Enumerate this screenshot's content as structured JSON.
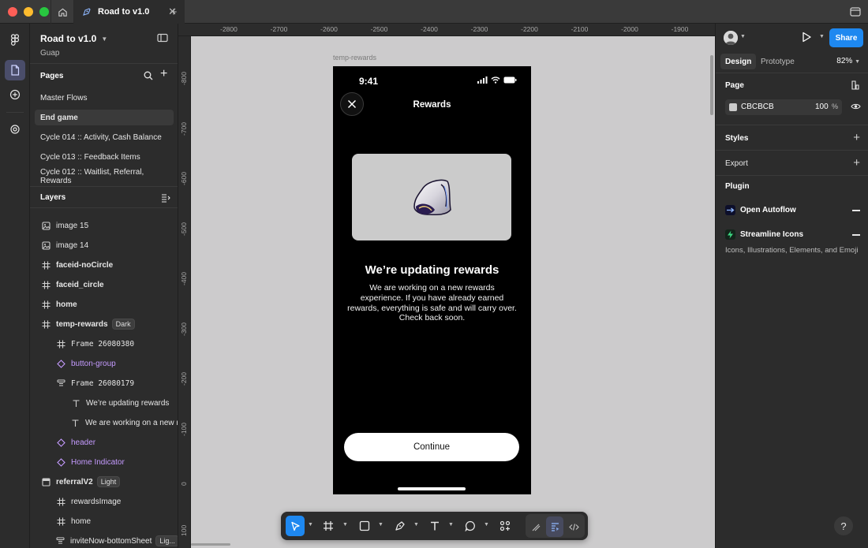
{
  "tab": {
    "title": "Road to v1.0"
  },
  "project": {
    "name": "Road to v1.0",
    "team": "Guap"
  },
  "pages": {
    "title": "Pages",
    "items": [
      {
        "label": "Master Flows",
        "selected": false
      },
      {
        "label": "End game",
        "selected": true
      },
      {
        "label": "Cycle 014 :: Activity, Cash Balance",
        "selected": false
      },
      {
        "label": "Cycle 013 :: Feedback Items",
        "selected": false
      },
      {
        "label": "Cycle 012 :: Waitlist, Referral, Rewards",
        "selected": false
      }
    ]
  },
  "layers": {
    "title": "Layers",
    "items": [
      {
        "label": "image 15",
        "icon": "image-icon",
        "indent": 0,
        "bold": false,
        "purple": false,
        "badge": ""
      },
      {
        "label": "image 14",
        "icon": "image-icon",
        "indent": 0,
        "bold": false,
        "purple": false,
        "badge": ""
      },
      {
        "label": "faceid-noCircle",
        "icon": "frame-icon",
        "indent": 0,
        "bold": true,
        "purple": false,
        "badge": ""
      },
      {
        "label": "faceid_circle",
        "icon": "frame-icon",
        "indent": 0,
        "bold": true,
        "purple": false,
        "badge": ""
      },
      {
        "label": "home",
        "icon": "frame-icon",
        "indent": 0,
        "bold": true,
        "purple": false,
        "badge": ""
      },
      {
        "label": "temp-rewards",
        "icon": "frame-icon",
        "indent": 0,
        "bold": true,
        "purple": false,
        "badge": "Dark"
      },
      {
        "label": "Frame 26080380",
        "icon": "frame-icon",
        "indent": 1,
        "bold": false,
        "purple": false,
        "badge": "",
        "mono": true
      },
      {
        "label": "button-group",
        "icon": "instance-icon",
        "indent": 1,
        "bold": false,
        "purple": true,
        "badge": ""
      },
      {
        "label": "Frame 26080179",
        "icon": "autolayout-icon",
        "indent": 1,
        "bold": false,
        "purple": false,
        "badge": "",
        "mono": true
      },
      {
        "label": "We’re updating rewards",
        "icon": "text-icon",
        "indent": 2,
        "bold": false,
        "purple": false,
        "badge": ""
      },
      {
        "label": "We are working on a new rew",
        "icon": "text-icon",
        "indent": 2,
        "bold": false,
        "purple": false,
        "badge": ""
      },
      {
        "label": "header",
        "icon": "instance-icon",
        "indent": 1,
        "bold": false,
        "purple": true,
        "badge": ""
      },
      {
        "label": "Home Indicator",
        "icon": "instance-icon",
        "indent": 1,
        "bold": false,
        "purple": true,
        "badge": ""
      },
      {
        "label": "referralV2",
        "icon": "section-icon",
        "indent": 0,
        "bold": true,
        "purple": false,
        "badge": "Light"
      },
      {
        "label": "rewardsImage",
        "icon": "frame-icon",
        "indent": 1,
        "bold": false,
        "purple": false,
        "badge": ""
      },
      {
        "label": "home",
        "icon": "frame-icon",
        "indent": 1,
        "bold": false,
        "purple": false,
        "badge": ""
      },
      {
        "label": "inviteNow-bottomSheet",
        "icon": "autolayout-icon",
        "indent": 1,
        "bold": false,
        "purple": false,
        "badge": "Lig..."
      }
    ]
  },
  "rulers": {
    "top": [
      "-2800",
      "-2700",
      "-2600",
      "-2500",
      "-2400",
      "-2300",
      "-2200",
      "-2100",
      "-2000",
      "-1900"
    ],
    "left": [
      "-800",
      "-700",
      "-600",
      "-500",
      "-400",
      "-300",
      "-200",
      "-100",
      "0",
      "100"
    ]
  },
  "frame": {
    "label": "temp-rewards",
    "time": "9:41",
    "header_title": "Rewards",
    "heading": "We’re updating rewards",
    "body": "We are working on a new rewards experience. If you have already earned rewards, everything is safe and will carry over. Check back soon.",
    "cta": "Continue"
  },
  "right": {
    "share": "Share",
    "tabs": [
      "Design",
      "Prototype"
    ],
    "zoom": "82%",
    "page_title": "Page",
    "page_color": "CBCBCB",
    "page_opacity": "100",
    "percent": "%",
    "styles_title": "Styles",
    "export_title": "Export",
    "plugin_title": "Plugin",
    "plugins": [
      {
        "name": "Open Autoflow"
      },
      {
        "name": "Streamline Icons"
      }
    ],
    "plugin_desc": "Icons, Illustrations, Elements, and Emoji"
  },
  "help": "?",
  "colors": {
    "accent": "#1e88f0",
    "component": "#c59bff",
    "canvas": "#cccbcc"
  }
}
